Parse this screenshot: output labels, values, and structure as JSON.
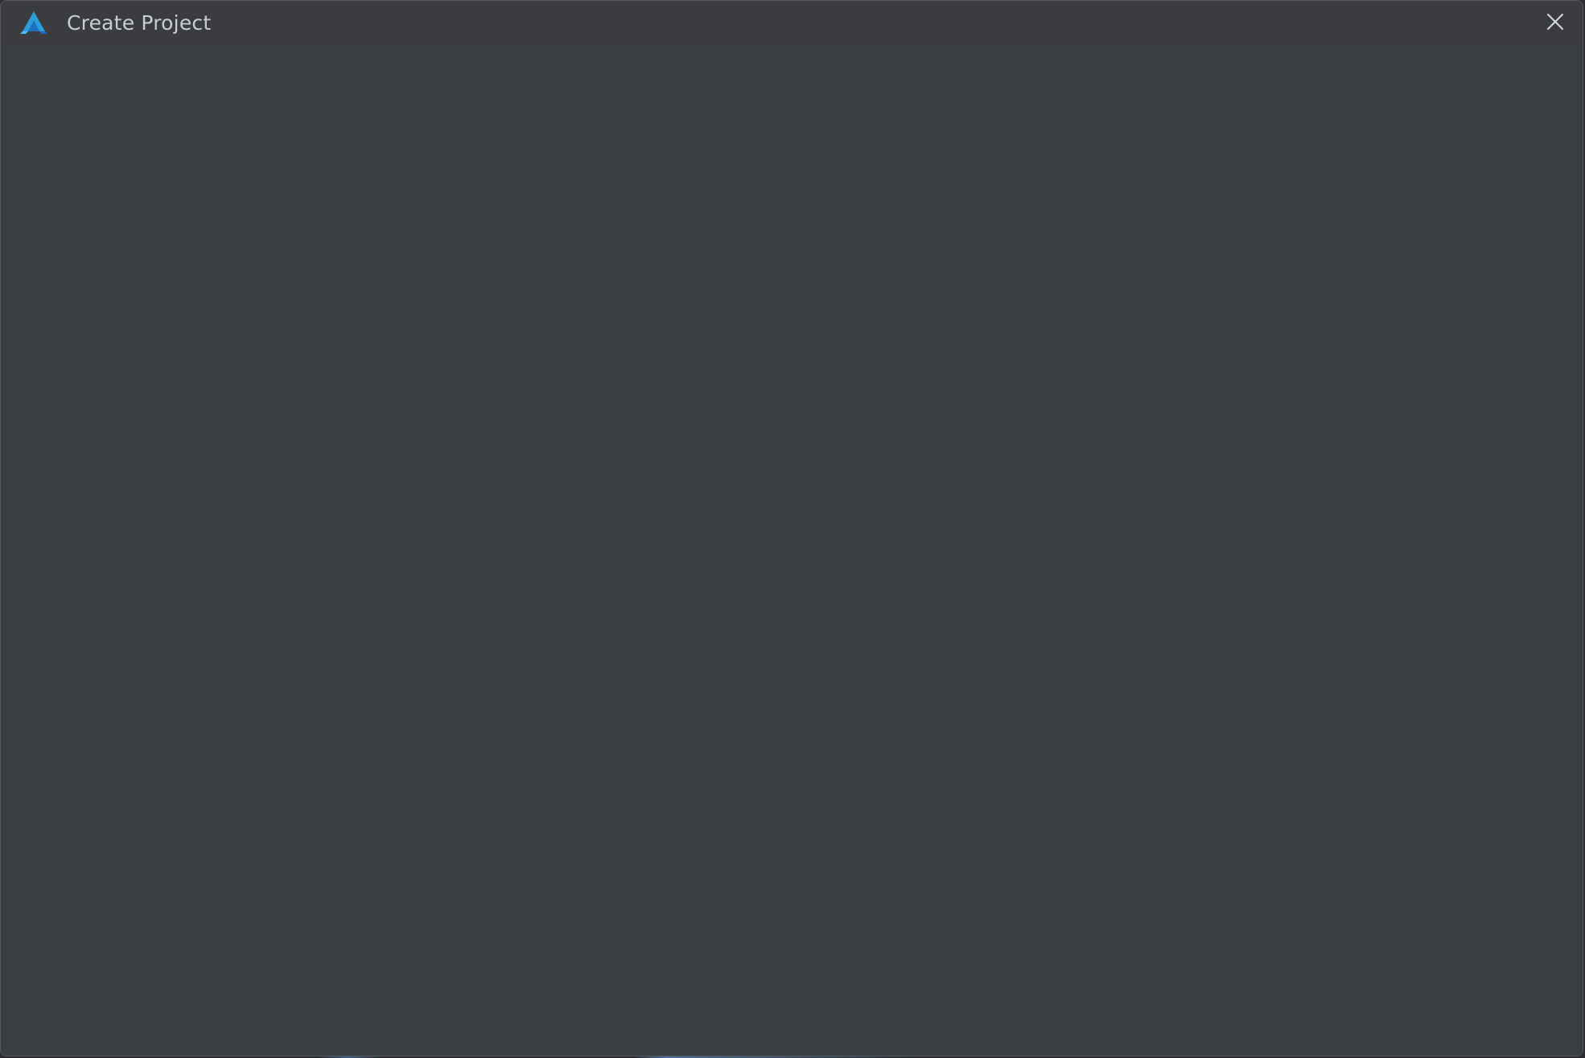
{
  "window": {
    "title": "Create Project"
  },
  "icons": {
    "logo": "app-logo-icon",
    "close": "close-icon"
  },
  "colors": {
    "logo_primary": "#2d9cdb",
    "logo_secondary": "#1b6fc2",
    "logo_accent": "#4fc3f7",
    "background": "#3c3f41",
    "title_text": "#c9cdd1"
  }
}
